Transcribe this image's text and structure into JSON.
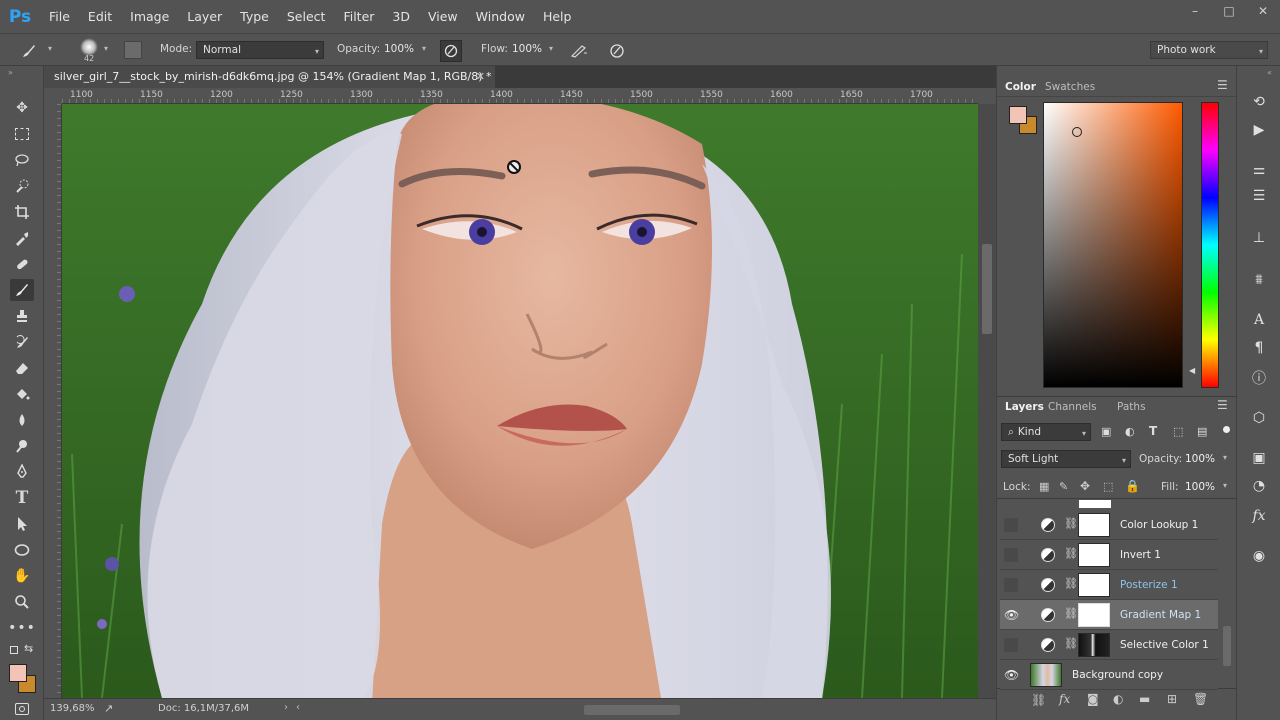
{
  "app": {
    "logo": "Ps",
    "menu": [
      "File",
      "Edit",
      "Image",
      "Layer",
      "Type",
      "Select",
      "Filter",
      "3D",
      "View",
      "Window",
      "Help"
    ],
    "window_controls": [
      "–",
      "□",
      "✕"
    ]
  },
  "options_bar": {
    "brush_size": "42",
    "mode_label": "Mode:",
    "mode_value": "Normal",
    "opacity_label": "Opacity:",
    "opacity_value": "100%",
    "flow_label": "Flow:",
    "flow_value": "100%",
    "workspace": "Photo work"
  },
  "document": {
    "tab_title": "silver_girl_7__stock_by_mirish-d6dk6mq.jpg @ 154% (Gradient Map 1, RGB/8) *",
    "close": "✕",
    "ruler_ticks": [
      "1100",
      "1150",
      "1200",
      "1250",
      "1300",
      "1350",
      "1400",
      "1450",
      "1500",
      "1550",
      "1600",
      "1650",
      "1700"
    ],
    "zoom": "139,68%",
    "doc_size": "Doc: 16,1M/37,6M"
  },
  "color_panel": {
    "tabs": [
      "Color",
      "Swatches"
    ],
    "foreground": "#f2c4b6",
    "background": "#c98a2e"
  },
  "layers_panel": {
    "tabs": [
      "Layers",
      "Channels",
      "Paths"
    ],
    "kind_label": "Kind",
    "blend_mode": "Soft Light",
    "opacity_label": "Opacity:",
    "opacity_value": "100%",
    "lock_label": "Lock:",
    "fill_label": "Fill:",
    "fill_value": "100%",
    "layers": [
      {
        "name": "Color Lookup 1",
        "visible": false,
        "selected": false
      },
      {
        "name": "Invert 1",
        "visible": false,
        "selected": false
      },
      {
        "name": "Posterize 1",
        "visible": false,
        "selected": false
      },
      {
        "name": "Gradient Map 1",
        "visible": true,
        "selected": true
      },
      {
        "name": "Selective Color 1",
        "visible": false,
        "selected": false
      },
      {
        "name": "Background copy",
        "visible": true,
        "selected": false
      }
    ]
  },
  "icons": {
    "eye": "eye-icon",
    "link": "link-icon",
    "adjustment": "adjustment-icon"
  }
}
